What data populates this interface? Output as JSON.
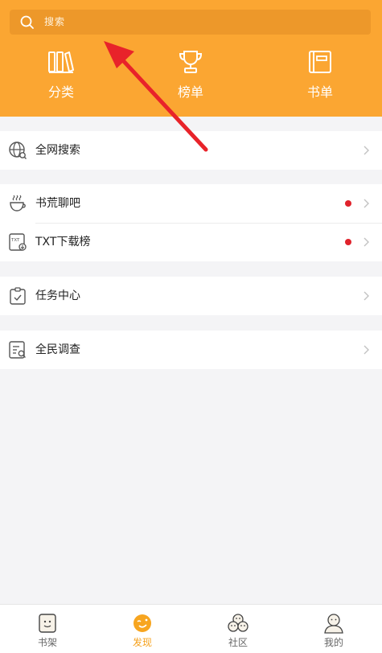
{
  "search": {
    "placeholder": "搜索"
  },
  "quick_nav": [
    {
      "label": "分类",
      "icon": "books-icon"
    },
    {
      "label": "榜单",
      "icon": "trophy-icon"
    },
    {
      "label": "书单",
      "icon": "booklist-icon"
    }
  ],
  "menu": {
    "groups": [
      {
        "items": [
          {
            "label": "全网搜索",
            "icon": "globe-search-icon",
            "has_dot": false
          }
        ]
      },
      {
        "items": [
          {
            "label": "书荒聊吧",
            "icon": "coffee-cup-icon",
            "has_dot": true
          },
          {
            "label": "TXT下载榜",
            "icon": "txt-download-icon",
            "has_dot": true
          }
        ]
      },
      {
        "items": [
          {
            "label": "任务中心",
            "icon": "task-clipboard-icon",
            "has_dot": false
          }
        ]
      },
      {
        "items": [
          {
            "label": "全民调查",
            "icon": "survey-icon",
            "has_dot": false
          }
        ]
      }
    ]
  },
  "tabbar": [
    {
      "label": "书架",
      "icon": "bookshelf-icon",
      "active": false
    },
    {
      "label": "发现",
      "icon": "discover-icon",
      "active": true
    },
    {
      "label": "社区",
      "icon": "community-icon",
      "active": false
    },
    {
      "label": "我的",
      "icon": "profile-icon",
      "active": false
    }
  ],
  "colors": {
    "header": "#fba632",
    "search_bg": "#ed982a",
    "accent": "#f5a11c",
    "badge_dot": "#e0232c",
    "annotation_arrow": "#e8232a"
  }
}
